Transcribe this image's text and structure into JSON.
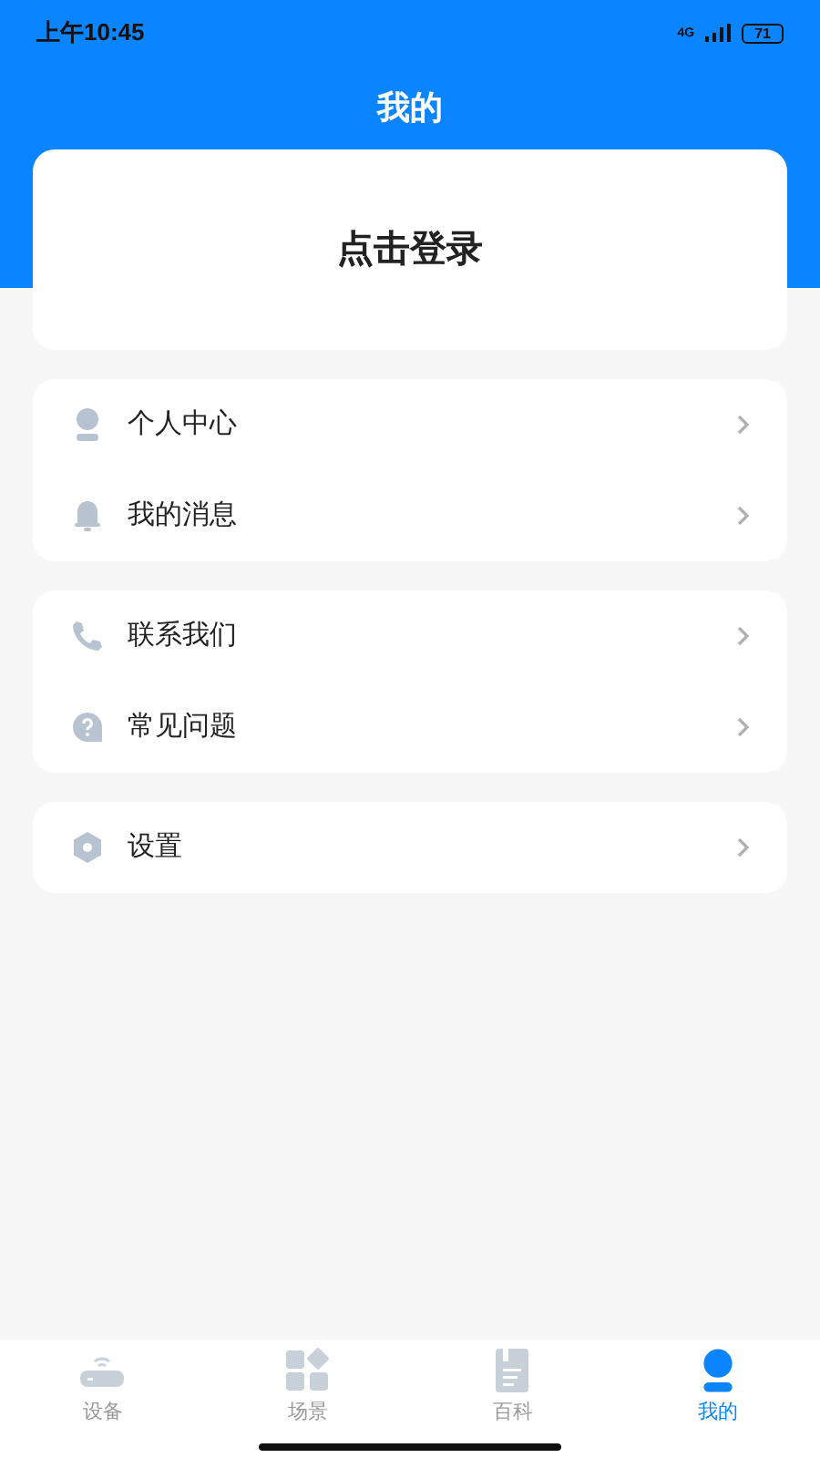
{
  "status_bar": {
    "time": "上午10:45",
    "network": "4G",
    "battery": "71"
  },
  "header": {
    "title": "我的"
  },
  "login_card": {
    "label": "点击登录"
  },
  "menu_groups": [
    {
      "items": [
        {
          "kind": "user",
          "label": "个人中心"
        },
        {
          "kind": "bell",
          "label": "我的消息"
        }
      ]
    },
    {
      "items": [
        {
          "kind": "phone",
          "label": "联系我们"
        },
        {
          "kind": "help",
          "label": "常见问题"
        }
      ]
    },
    {
      "items": [
        {
          "kind": "settings",
          "label": "设置"
        }
      ]
    }
  ],
  "tab_bar": [
    {
      "kind": "device",
      "label": "设备",
      "selected": false
    },
    {
      "kind": "scene",
      "label": "场景",
      "selected": false
    },
    {
      "kind": "wiki",
      "label": "百科",
      "selected": false
    },
    {
      "kind": "user",
      "label": "我的",
      "selected": true
    }
  ]
}
